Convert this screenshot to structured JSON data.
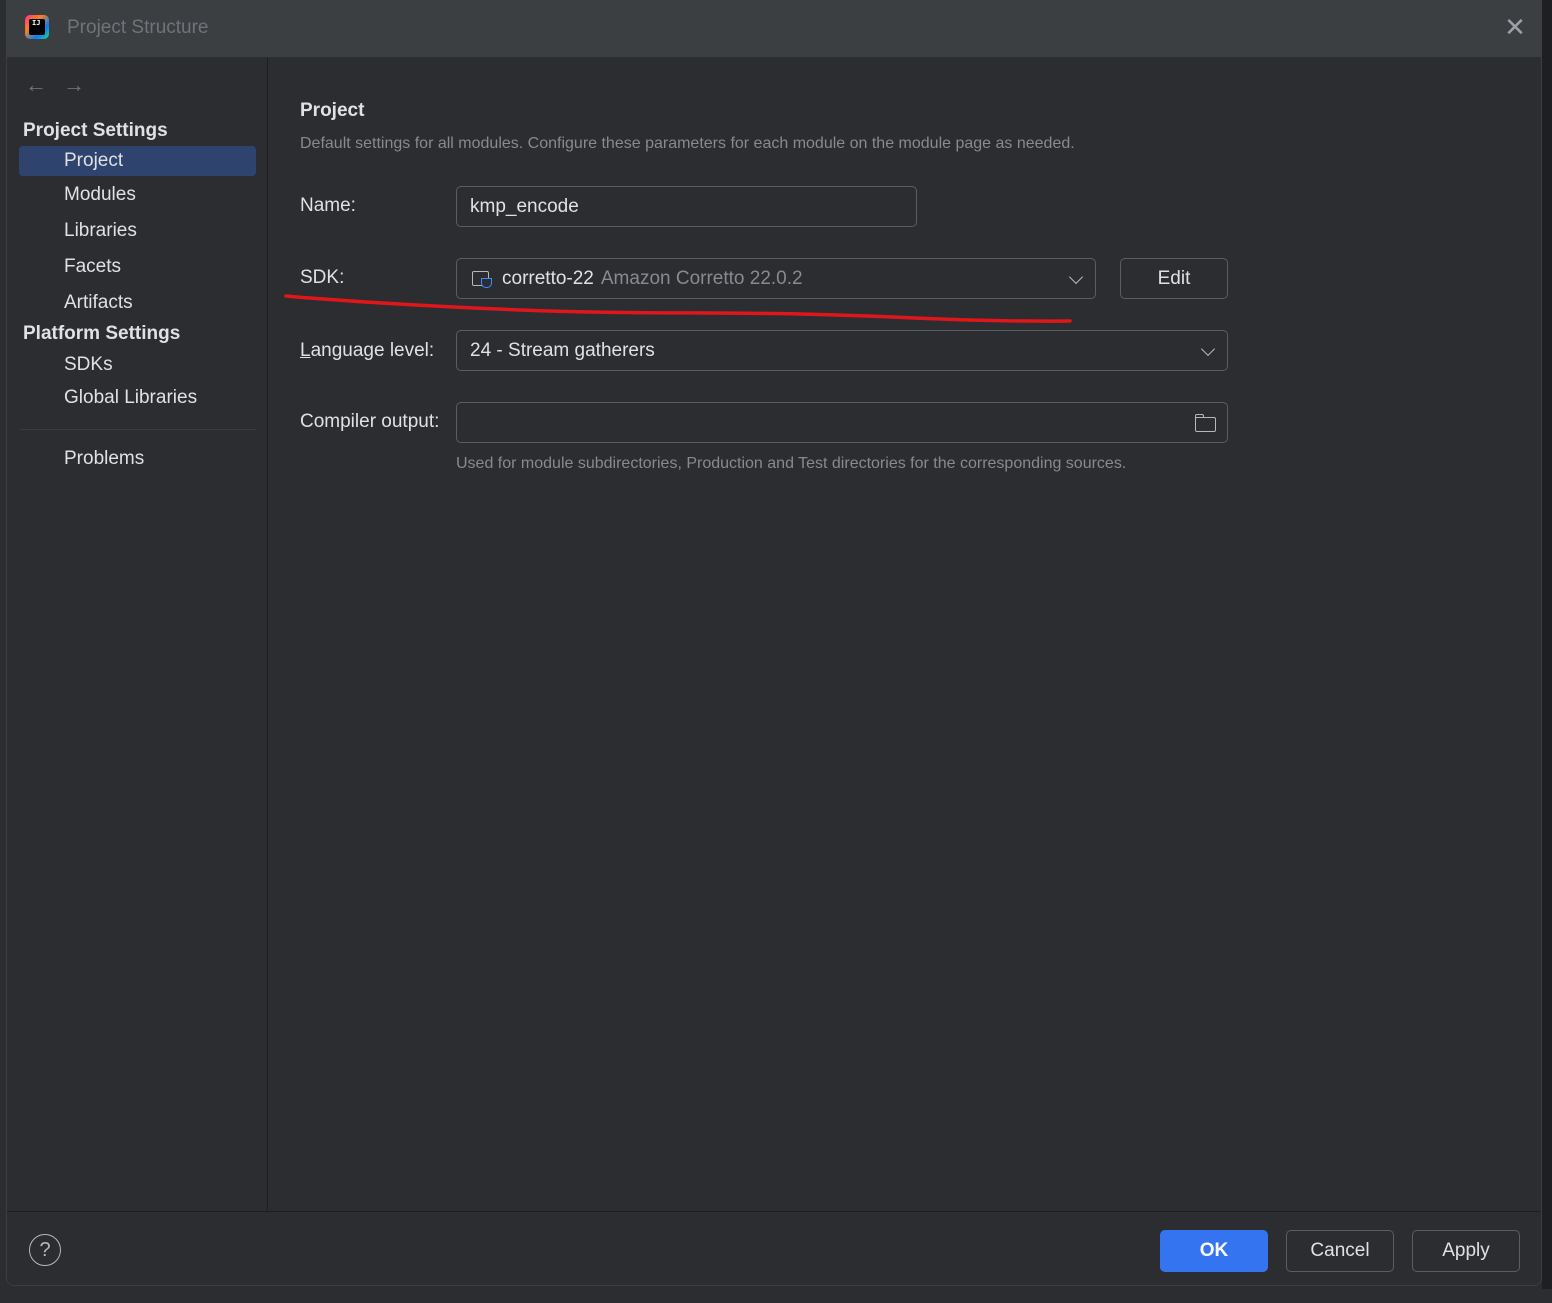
{
  "window": {
    "title": "Project Structure",
    "logo_text": "IJ"
  },
  "sidebar": {
    "back_arrow": "←",
    "forward_arrow": "→",
    "project_settings_header": "Project Settings",
    "project_settings_items": [
      "Project",
      "Modules",
      "Libraries",
      "Facets",
      "Artifacts"
    ],
    "platform_settings_header": "Platform Settings",
    "platform_settings_items": [
      "SDKs",
      "Global Libraries"
    ],
    "problems_label": "Problems",
    "selected_item": "Project"
  },
  "main": {
    "title": "Project",
    "description": "Default settings for all modules. Configure these parameters for each module on the module page as needed.",
    "name_label": "Name:",
    "name_value": "kmp_encode",
    "sdk_label": "SDK:",
    "sdk_value": "corretto-22",
    "sdk_detail": "Amazon Corretto 22.0.2",
    "sdk_edit_label": "Edit",
    "language_level_label_accesskey": "L",
    "language_level_label_rest": "anguage level:",
    "language_level_value": "24 - Stream gatherers",
    "compiler_output_label": "Compiler output:",
    "compiler_output_value": "",
    "compiler_output_hint": "Used for module subdirectories, Production and Test directories for the corresponding sources."
  },
  "footer": {
    "help_label": "?",
    "ok_label": "OK",
    "cancel_label": "Cancel",
    "apply_label": "Apply"
  },
  "colors": {
    "accent": "#3574f0",
    "selection": "#2e436e",
    "annotation_stroke": "#e0161b"
  },
  "icons": {
    "close": "close-icon",
    "sdk": "jdk-folder-icon",
    "folder": "folder-icon",
    "help": "help-icon",
    "dropdown": "chevron-down-icon"
  }
}
